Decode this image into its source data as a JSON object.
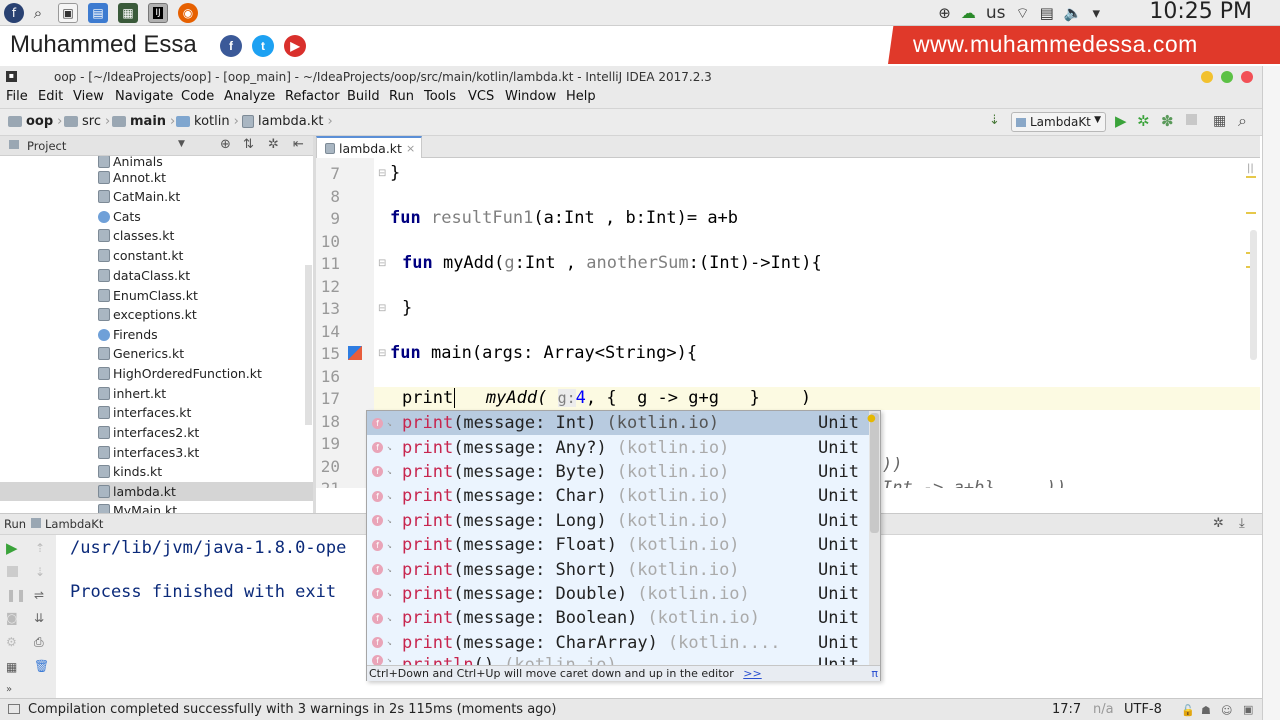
{
  "desktop": {
    "keyboard_layout": "us",
    "clock": "10:25 PM"
  },
  "banner": {
    "brand": "Muhammed Essa",
    "website": "www.muhammedessa.com",
    "social": [
      "f",
      "t",
      "▶"
    ]
  },
  "window": {
    "title": "oop - [~/IdeaProjects/oop] - [oop_main] - ~/IdeaProjects/oop/src/main/kotlin/lambda.kt - IntelliJ IDEA 2017.2.3"
  },
  "menu": [
    "File",
    "Edit",
    "View",
    "Navigate",
    "Code",
    "Analyze",
    "Refactor",
    "Build",
    "Run",
    "Tools",
    "VCS",
    "Window",
    "Help"
  ],
  "breadcrumb": [
    "oop",
    "src",
    "main",
    "kotlin",
    "lambda.kt"
  ],
  "run_config": "LambdaKt",
  "project_panel": {
    "title": "Project",
    "items": [
      "Animals",
      "Annot.kt",
      "CatMain.kt",
      "Cats",
      "classes.kt",
      "constant.kt",
      "dataClass.kt",
      "EnumClass.kt",
      "exceptions.kt",
      "Firends",
      "Generics.kt",
      "HighOrderedFunction.kt",
      "inhert.kt",
      "interfaces.kt",
      "interfaces2.kt",
      "interfaces3.kt",
      "kinds.kt",
      "lambda.kt",
      "MyMain.kt"
    ],
    "selected": "lambda.kt"
  },
  "editor": {
    "tab": "lambda.kt",
    "line_numbers": [
      "7",
      "8",
      "9",
      "10",
      "11",
      "12",
      "13",
      "14",
      "15",
      "16",
      "17",
      "18",
      "19",
      "20",
      "21"
    ],
    "line7": "}",
    "line9_kw": "fun",
    "line9_name": "resultFun1",
    "line9_rest": "(a:Int , b:Int)= a+b",
    "line11_kw": "fun",
    "line11_a": " myAdd(",
    "line11_g": "g",
    "line11_b": ":Int , ",
    "line11_other": "anotherSum",
    "line11_c": ":(Int)->Int){",
    "line13": "}",
    "line15_kw": "fun",
    "line15_rest": " main(args: Array<String>){",
    "line17_typed": "print",
    "line17_call": "myAdd(",
    "line17_hint": "g:",
    "line17_num": "4",
    "line17_rest": ", {  g -> g+g   }    )",
    "line20_tail": "))",
    "line21_tail": "Int -> a+b}     ))"
  },
  "completion": {
    "rows": [
      {
        "name": "print",
        "args": "(message: Int)",
        "pkg": "(kotlin.io)",
        "type": "Unit"
      },
      {
        "name": "print",
        "args": "(message: Any?)",
        "pkg": "(kotlin.io)",
        "type": "Unit"
      },
      {
        "name": "print",
        "args": "(message: Byte)",
        "pkg": "(kotlin.io)",
        "type": "Unit"
      },
      {
        "name": "print",
        "args": "(message: Char)",
        "pkg": "(kotlin.io)",
        "type": "Unit"
      },
      {
        "name": "print",
        "args": "(message: Long)",
        "pkg": "(kotlin.io)",
        "type": "Unit"
      },
      {
        "name": "print",
        "args": "(message: Float)",
        "pkg": "(kotlin.io)",
        "type": "Unit"
      },
      {
        "name": "print",
        "args": "(message: Short)",
        "pkg": "(kotlin.io)",
        "type": "Unit"
      },
      {
        "name": "print",
        "args": "(message: Double)",
        "pkg": "(kotlin.io)",
        "type": "Unit"
      },
      {
        "name": "print",
        "args": "(message: Boolean)",
        "pkg": "(kotlin.io)",
        "type": "Unit"
      },
      {
        "name": "print",
        "args": "(message: CharArray)",
        "pkg": "(kotlin....",
        "type": "Unit"
      },
      {
        "name": "println",
        "args": "()",
        "pkg": "(kotlin.io)",
        "type": "Unit"
      }
    ],
    "footer": "Ctrl+Down and Ctrl+Up will move caret down and up in the editor",
    "footer_link": ">>",
    "corner": "π"
  },
  "run_panel": {
    "title": "Run",
    "config": "LambdaKt",
    "line1": "/usr/lib/jvm/java-1.8.0-ope",
    "line2": "Process finished with exit"
  },
  "status_bar": {
    "message": "Compilation completed successfully with 3 warnings in 2s 115ms (moments ago)",
    "position": "17:7",
    "separator": "n/a",
    "encoding": "UTF-8"
  }
}
